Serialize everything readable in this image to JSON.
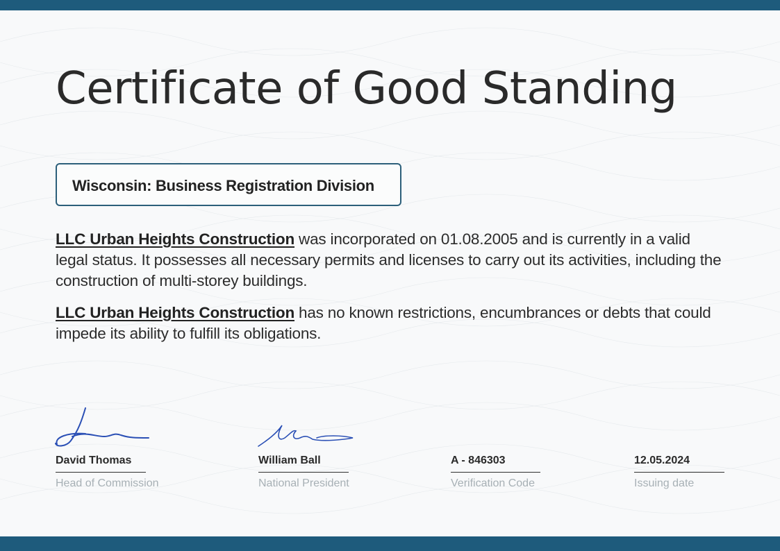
{
  "certificate": {
    "title": "Certificate of Good Standing",
    "division": "Wisconsin: Business Registration Division",
    "company_name": "LLC Urban Heights Construction",
    "paragraph1_text": " was incorporated on 01.08.2005 and is currently in a valid legal status. It possesses all necessary permits and licenses to carry out its activities, including the construction of multi-storey buildings.",
    "paragraph2_text": " has no known restrictions, encumbrances or debts that could impede its ability to fulfill its obligations."
  },
  "footer": {
    "signatories": [
      {
        "name": "David Thomas",
        "role": "Head of Commission"
      },
      {
        "name": "William Ball",
        "role": "National President"
      }
    ],
    "verification": {
      "value": "A - 846303",
      "label": "Verification Code"
    },
    "issuing": {
      "value": "12.05.2024",
      "label": "Issuing date"
    }
  },
  "colors": {
    "accent": "#1e5b7c",
    "signature_ink": "#2a4fb5",
    "caption": "#a7b0b5"
  }
}
